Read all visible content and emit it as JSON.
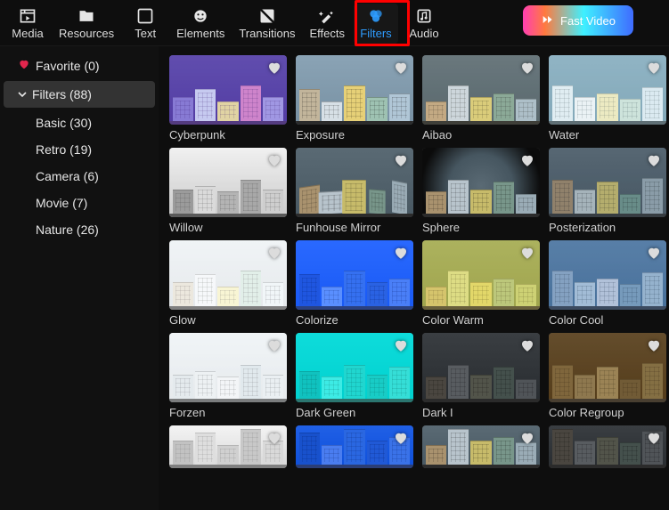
{
  "topbar": {
    "items": [
      {
        "id": "media",
        "label": "Media",
        "icon": "media-icon"
      },
      {
        "id": "resources",
        "label": "Resources",
        "icon": "resources-icon"
      },
      {
        "id": "text",
        "label": "Text",
        "icon": "text-icon"
      },
      {
        "id": "elements",
        "label": "Elements",
        "icon": "elements-icon"
      },
      {
        "id": "transitions",
        "label": "Transitions",
        "icon": "transitions-icon"
      },
      {
        "id": "effects",
        "label": "Effects",
        "icon": "effects-icon"
      },
      {
        "id": "filters",
        "label": "Filters",
        "icon": "filters-icon",
        "active": true
      },
      {
        "id": "audio",
        "label": "Audio",
        "icon": "audio-icon"
      }
    ],
    "fast_video_label": "Fast Video"
  },
  "sidebar": {
    "favorite": {
      "label": "Favorite",
      "count": 0
    },
    "root": {
      "label": "Filters",
      "count": 88
    },
    "items": [
      {
        "id": "basic",
        "label": "Basic",
        "count": 30
      },
      {
        "id": "retro",
        "label": "Retro",
        "count": 19
      },
      {
        "id": "camera",
        "label": "Camera",
        "count": 6
      },
      {
        "id": "movie",
        "label": "Movie",
        "count": 7
      },
      {
        "id": "nature",
        "label": "Nature",
        "count": 26
      }
    ]
  },
  "filters": [
    {
      "name": "Cyberpunk",
      "sky": "#3b3f78",
      "bc": [
        "#6a6fb8",
        "#b8c6e6",
        "#d9cf66",
        "#c27aa8",
        "#8a8fd0"
      ],
      "tint": "#7a2fff"
    },
    {
      "name": "Exposure",
      "sky": "#8aa3b5",
      "bc": [
        "#c2b59b",
        "#d7e0e6",
        "#e6d077",
        "#9ec2b2",
        "#b0c6d6"
      ],
      "tint": null
    },
    {
      "name": "Aibao",
      "sky": "#5a6a74",
      "bc": [
        "#bda07a",
        "#c8d2d8",
        "#d6c770",
        "#7fa090",
        "#a5b8c4"
      ],
      "tint": "#3a3a2a"
    },
    {
      "name": "Water",
      "sky": "#6b90a4",
      "bc": [
        "#d6e4eb",
        "#e4ecf0",
        "#e6e0a0",
        "#bcd6c8",
        "#cfe0e9"
      ],
      "tint": "#a0d0e0"
    },
    {
      "name": "Willow",
      "sky": "#b4b4b4",
      "bc": [
        "#808080",
        "#d0d0d0",
        "#a0a0a0",
        "#909090",
        "#c0c0c0"
      ],
      "tint": "#888888",
      "gray": true
    },
    {
      "name": "Funhouse Mirror",
      "sky": "#5a6a74",
      "bc": [
        "#a9926e",
        "#b8c4cc",
        "#c7bb6a",
        "#78968a",
        "#9aacb6"
      ],
      "tint": null,
      "distort": true
    },
    {
      "name": "Sphere",
      "sky": "#5a6a74",
      "bc": [
        "#a9926e",
        "#b8c4cc",
        "#c7bb6a",
        "#78968a",
        "#9aacb6"
      ],
      "tint": null,
      "radial": true
    },
    {
      "name": "Posterization",
      "sky": "#4e5a63",
      "bc": [
        "#8a765a",
        "#a0acb2",
        "#b0a65c",
        "#60827a",
        "#84949e"
      ],
      "tint": "#203040"
    },
    {
      "name": "Glow",
      "sky": "#e6ecf0",
      "bc": [
        "#e0d8c8",
        "#f0f4f6",
        "#f4eeb8",
        "#cfe4da",
        "#e8f0f4"
      ],
      "tint": "#ffffff"
    },
    {
      "name": "Colorize",
      "sky": "#2a58ff",
      "bc": [
        "#1f43cc",
        "#5a82ff",
        "#3560e6",
        "#2a50d0",
        "#4a70f2"
      ],
      "tint": "#0040ff"
    },
    {
      "name": "Color Warm",
      "sky": "#8a9850",
      "bc": [
        "#c4b060",
        "#cfd07a",
        "#d6ca5c",
        "#a0b470",
        "#b8c268"
      ],
      "tint": "#b8a030"
    },
    {
      "name": "Color Cool",
      "sky": "#4a688a",
      "bc": [
        "#7a90ac",
        "#9ab0c8",
        "#aab6cc",
        "#6a88a4",
        "#8ca4bc"
      ],
      "tint": "#3060a0"
    },
    {
      "name": "Forzen",
      "sky": "#e8eef2",
      "bc": [
        "#d4dce2",
        "#e2e8ec",
        "#eceff2",
        "#cfdbe2",
        "#dde5ea"
      ],
      "tint": "#f0f6fa"
    },
    {
      "name": "Dark Green",
      "sky": "#0ec9c9",
      "bc": [
        "#10a0a0",
        "#3de0d8",
        "#20c0b8",
        "#18b0aa",
        "#35ccc4"
      ],
      "tint": "#00e0d0"
    },
    {
      "name": "Dark I",
      "sky": "#3a3e42",
      "bc": [
        "#4a4640",
        "#585c60",
        "#52544a",
        "#44504c",
        "#505458"
      ],
      "tint": "#000000"
    },
    {
      "name": "Color Regroup",
      "sky": "#4a3a26",
      "bc": [
        "#6a5636",
        "#7c6a4a",
        "#8a7650",
        "#5a4a30",
        "#70603e"
      ],
      "tint": "#5a3a10"
    },
    {
      "name": "",
      "sky": "#dcdcdc",
      "bc": [
        "#9a9a9a",
        "#c8c8c8",
        "#b0b0b0",
        "#a4a4a4",
        "#c0c0c0"
      ],
      "tint": "#ffffff",
      "gray": true,
      "partial": true
    },
    {
      "name": "",
      "sky": "#2050d8",
      "bc": [
        "#1840b0",
        "#4a70e8",
        "#2a58d0",
        "#2048c0",
        "#3a64dc"
      ],
      "tint": "#0038e0",
      "partial": true
    },
    {
      "name": "",
      "sky": "#5a6a74",
      "bc": [
        "#a9926e",
        "#b8c4cc",
        "#c7bb6a",
        "#78968a",
        "#9aacb6"
      ],
      "tint": null,
      "partial": true
    },
    {
      "name": "",
      "sky": "#3a3e42",
      "bc": [
        "#4a4640",
        "#585c60",
        "#52544a",
        "#44504c",
        "#505458"
      ],
      "tint": "#000000",
      "partial": true
    }
  ]
}
